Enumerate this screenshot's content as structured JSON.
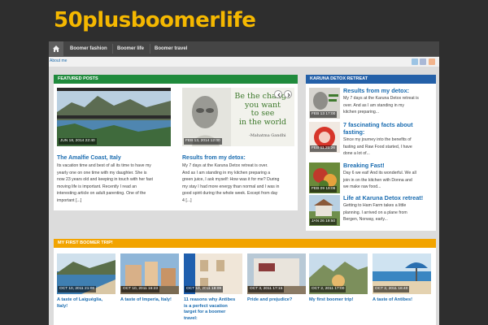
{
  "site": {
    "title": "50plusboomerlife"
  },
  "nav": {
    "items": [
      "Boomer fashion",
      "Boomer life",
      "Boomer travel"
    ]
  },
  "subnav": {
    "about": "About me"
  },
  "featured": {
    "heading": "FEATURED POSTS",
    "posts": [
      {
        "date": "JUN 18, 2014 22:40",
        "title": "The Amalfie Coast, Italy",
        "excerpt": [
          "Its vacation time and best of all its time to have my",
          "yearly one on one time with my daughter. She is",
          "now 23 years old and keeping in touch with her fast",
          "moving life is important. Recently I read an",
          "interesting article on adult parenting. One of the",
          "important [...]"
        ]
      },
      {
        "date": "FEB 13, 2014 12:00",
        "title": "Results from my detox:",
        "quote": [
          "Be the change",
          "you want",
          "to see",
          "in the world"
        ],
        "quote_author": "-Mahatma Gandhi",
        "excerpt": [
          "My 7 days at the Karuna Detox retreat is over.",
          "And as I am standing in my kitchen preparing a",
          "green juice, I ask myself: How was it for me? During",
          "my stay I had more energy than normal and I was in",
          "good spirit during the whole week. Except from day",
          "4 [...]"
        ]
      }
    ]
  },
  "sidebar": {
    "heading": "KARUNA DETOX RETREAT",
    "posts": [
      {
        "date": "FEB 13 17:00",
        "title": "Results from my detox:",
        "excerpt": [
          "My 7 days at the Karuna Detox retreat is",
          "over. And as I am standing in my",
          "kitchen preparing..."
        ]
      },
      {
        "date": "FEB 11 21:26",
        "title": "7 fascinating facts about fasting:",
        "excerpt": [
          "Since my journey into the benefits of",
          "fasting and Raw Food started, I have",
          "done a lot of..."
        ]
      },
      {
        "date": "FEB 09 19:06",
        "title": "Breaking Fast!",
        "excerpt": [
          "Day 6 we eat! And its wonderful. We all",
          "join in on the kitchen with Donna and",
          "we make raw food..."
        ]
      },
      {
        "date": "JAN 26 19:50",
        "title": "Life at Karuna Detox retreat!",
        "excerpt": [
          "Getting to Ham Farm takes a little",
          "planning. I arrived on a plane from",
          "Bergen, Norway, early..."
        ]
      }
    ]
  },
  "trips": {
    "heading": "MY FIRST BOOMER TRIP!",
    "posts": [
      {
        "date": "OCT 10, 2011 21:08",
        "title": [
          "A taste of Laiguéglia,",
          "Italy!"
        ]
      },
      {
        "date": "OCT 10, 2011 16:23",
        "title": [
          "A taste of Imperia, Italy!"
        ]
      },
      {
        "date": "OCT 10, 2011 18:09",
        "title": [
          "11 reasons why Antibes",
          "is a perfect vacation",
          "target for a boomer",
          "travel:"
        ]
      },
      {
        "date": "OCT 3, 2011 17:15",
        "title": [
          "Pride and prejudice?"
        ]
      },
      {
        "date": "OCT 2, 2011 17:00",
        "title": [
          "My first boomer trip!"
        ]
      },
      {
        "date": "OCT 2, 2011 16:40",
        "title": [
          "A taste of Antibes!"
        ]
      }
    ]
  },
  "colors": {
    "title": "#f5b800",
    "featured_head": "#1f8a3c",
    "sidebar_head": "#2460a8",
    "trips_head": "#f2a400",
    "link": "#1a6cb0"
  },
  "icons": {
    "home": "home-icon",
    "prev": "chevron-left-icon",
    "next": "chevron-right-icon",
    "twitter": "twitter-icon",
    "facebook": "facebook-icon",
    "rss": "rss-icon"
  }
}
